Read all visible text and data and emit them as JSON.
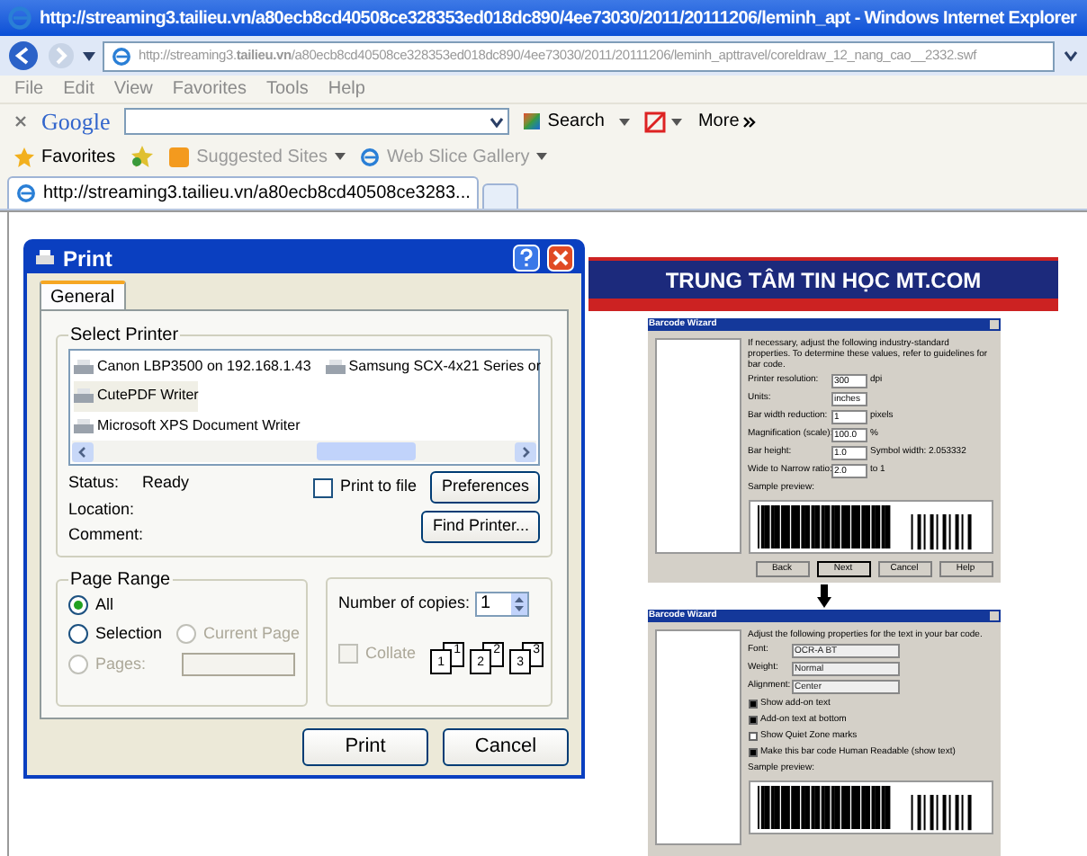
{
  "browser": {
    "title": "http://streaming3.tailieu.vn/a80ecb8cd40508ce328353ed018dc890/4ee73030/2011/20111206/leminh_apt - Windows Internet Explorer",
    "address": "http://streaming3.**tailieu.vn**/a80ecb8cd40508ce328353ed018dc890/4ee73030/2011/20111206/leminh_apttravel/coreldraw_12_nang_cao__2332.swf",
    "menu": [
      "File",
      "Edit",
      "View",
      "Favorites",
      "Tools",
      "Help"
    ],
    "google": {
      "logo": "Google",
      "search": "Search",
      "more": "More"
    },
    "favorites": {
      "label": "Favorites",
      "links": [
        "Suggested Sites",
        "Web Slice Gallery"
      ]
    },
    "tabs": [
      {
        "label": "http://streaming3.tailieu.vn/a80ecb8cd40508ce3283...",
        "selected": true
      }
    ]
  },
  "print_dialog": {
    "title": "Print",
    "tabs": [
      {
        "label": "General",
        "selected": true
      }
    ],
    "select_printer": {
      "label": "Select Printer",
      "printers": [
        {
          "name": "Canon LBP3500 on 192.168.1.43",
          "selected": false
        },
        {
          "name": "CutePDF Writer",
          "selected": true
        },
        {
          "name": "Microsoft XPS Document Writer",
          "selected": false
        },
        {
          "name": "Samsung SCX-4x21 Series or",
          "selected": false
        }
      ],
      "status_label": "Status:",
      "status": "Ready",
      "location_label": "Location:",
      "comment_label": "Comment:",
      "print_to_file": {
        "label": "Print to file",
        "checked": false
      },
      "preferences": "Preferences",
      "find_printer": "Find Printer..."
    },
    "page_range": {
      "label": "Page Range",
      "options": [
        {
          "label": "All",
          "selected": true,
          "disabled": false
        },
        {
          "label": "Selection",
          "selected": false,
          "disabled": false
        },
        {
          "label": "Current Page",
          "selected": false,
          "disabled": true
        },
        {
          "label": "Pages:",
          "selected": false,
          "disabled": true
        }
      ]
    },
    "copies": {
      "label": "Number of copies:",
      "value": "1",
      "collate": {
        "label": "Collate",
        "checked": false,
        "disabled": true
      },
      "collate_sets": [
        [
          "1",
          "1"
        ],
        [
          "2",
          "2"
        ],
        [
          "3",
          "3"
        ]
      ]
    },
    "buttons": [
      "Print",
      "Cancel"
    ]
  },
  "document": {
    "banner": {
      "title": "TRUNG TÂM TIN HỌC MT.COM"
    },
    "wizard_properties": {
      "title": "Barcode Wizard",
      "intro": "If necessary, adjust the following industry-standard properties. To determine these values, refer to guidelines for bar code.",
      "fields": [
        {
          "label": "Printer resolution:",
          "value": "300",
          "unit": "dpi"
        },
        {
          "label": "Units:",
          "value": "inches"
        },
        {
          "label": "Bar width reduction:",
          "value": "1",
          "unit": "pixels"
        },
        {
          "label": "Magnification (scale):",
          "value": "100.0",
          "unit": "%"
        },
        {
          "label": "Bar height:",
          "value": "1.0",
          "unit": "Symbol width: 2.053332"
        },
        {
          "label": "Wide to Narrow ratio:",
          "value": "2.0",
          "unit": "to 1"
        }
      ],
      "preview_label": "Sample preview:",
      "buttons": [
        "Back",
        "Next",
        "Cancel",
        "Help"
      ]
    },
    "wizard_text": {
      "title": "Barcode Wizard",
      "intro": "Adjust the following properties for the text in your bar code.",
      "fields": [
        {
          "label": "Font:",
          "value": "OCR-A BT"
        },
        {
          "label": "Weight:",
          "value": "Normal"
        },
        {
          "label": "Alignment:",
          "value": "Center"
        }
      ],
      "options": [
        {
          "label": "Show add-on text",
          "checked": true
        },
        {
          "label": "Add-on text at bottom",
          "checked": true
        },
        {
          "label": "Show Quiet Zone marks",
          "checked": false
        },
        {
          "label": "Make this bar code Human Readable (show text)",
          "checked": true
        }
      ],
      "preview_label": "Sample preview:"
    }
  }
}
